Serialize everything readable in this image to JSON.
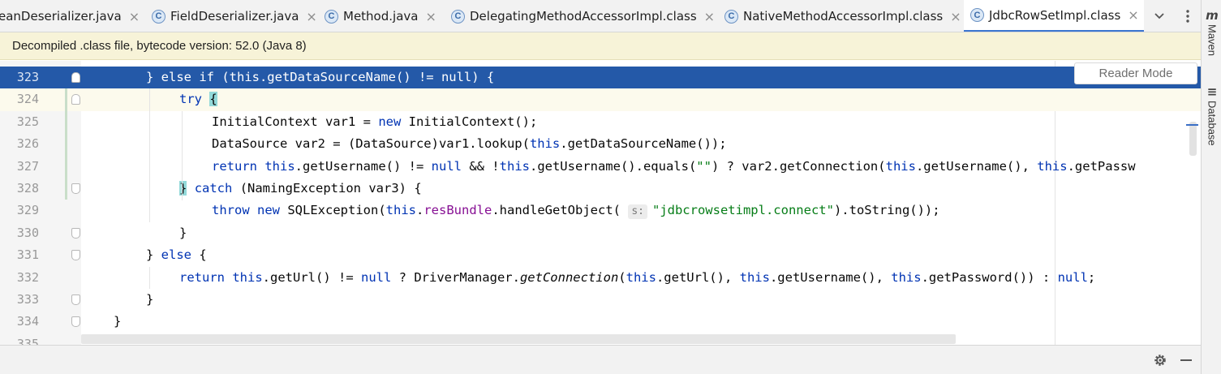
{
  "tabs": [
    {
      "label": "eanDeserializer.java",
      "icon": "class-c-icon",
      "active": false
    },
    {
      "label": "FieldDeserializer.java",
      "icon": "class-c-icon",
      "active": false
    },
    {
      "label": "Method.java",
      "icon": "class-c-icon",
      "active": false
    },
    {
      "label": "DelegatingMethodAccessorImpl.class",
      "icon": "class-c-icon",
      "active": false
    },
    {
      "label": "NativeMethodAccessorImpl.class",
      "icon": "class-c-icon",
      "active": false
    },
    {
      "label": "JdbcRowSetImpl.class",
      "icon": "class-c-icon",
      "active": true
    }
  ],
  "tab_icon_letter": "C",
  "tab_close_glyph": "×",
  "banner": {
    "text": "Decompiled .class file, bytecode version: 52.0 (Java 8)"
  },
  "reader_mode": {
    "label": "Reader Mode"
  },
  "side_tools": [
    {
      "label": "Maven",
      "icon": "maven-icon",
      "glyph": "m"
    },
    {
      "label": "Database",
      "icon": "database-icon",
      "glyph": "≡"
    }
  ],
  "code_lines": [
    {
      "num": "323",
      "text": "} else if (this.getDataSourceName() != null) {"
    },
    {
      "num": "324",
      "text": "try {"
    },
    {
      "num": "325",
      "text": "InitialContext var1 = new InitialContext();"
    },
    {
      "num": "326",
      "text": "DataSource var2 = (DataSource)var1.lookup(this.getDataSourceName());"
    },
    {
      "num": "327",
      "text": "return this.getUsername() != null && !this.getUsername().equals(\"\") ? var2.getConnection(this.getUsername(), this.getPassw"
    },
    {
      "num": "328",
      "text": "} catch (NamingException var3) {"
    },
    {
      "num": "329",
      "text": "throw new SQLException(this.resBundle.handleGetObject( s: \"jdbcrowsetimpl.connect\").toString());"
    },
    {
      "num": "330",
      "text": "}"
    },
    {
      "num": "331",
      "text": "} else {"
    },
    {
      "num": "332",
      "text": "return this.getUrl() != null ? DriverManager.getConnection(this.getUrl(), this.getUsername(), this.getPassword()) : null;"
    },
    {
      "num": "333",
      "text": "}"
    },
    {
      "num": "334",
      "text": "}"
    },
    {
      "num": "335",
      "text": ""
    }
  ],
  "param_hint": "s:",
  "colors": {
    "selection": "#2459a8",
    "keyword": "#0033b3",
    "string": "#067d17",
    "field": "#871094",
    "banner_bg": "#f7f3d8",
    "active_tab_underline": "#3c75cf"
  }
}
